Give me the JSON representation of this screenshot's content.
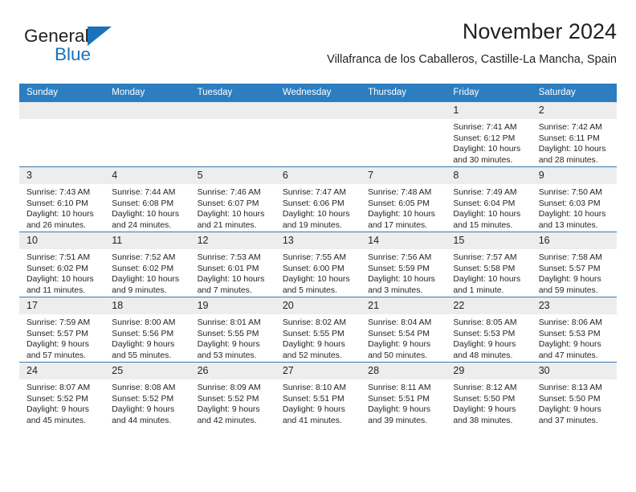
{
  "brand": {
    "name_part1": "General",
    "name_part2": "Blue",
    "accent_color": "#1a72ba"
  },
  "header": {
    "title": "November 2024",
    "subtitle": "Villafranca de los Caballeros, Castille-La Mancha, Spain"
  },
  "theme": {
    "header_row_color": "#2d7dc1",
    "daynum_bg": "#ededed",
    "border_color": "#3c78aa"
  },
  "weekdays": [
    "Sunday",
    "Monday",
    "Tuesday",
    "Wednesday",
    "Thursday",
    "Friday",
    "Saturday"
  ],
  "labels": {
    "sunrise_prefix": "Sunrise:",
    "sunset_prefix": "Sunset:",
    "daylight_prefix": "Daylight:"
  },
  "weeks": [
    [
      {
        "day": "",
        "empty": true
      },
      {
        "day": "",
        "empty": true
      },
      {
        "day": "",
        "empty": true
      },
      {
        "day": "",
        "empty": true
      },
      {
        "day": "",
        "empty": true
      },
      {
        "day": "1",
        "sunrise": "Sunrise: 7:41 AM",
        "sunset": "Sunset: 6:12 PM",
        "daylight_1": "Daylight: 10 hours",
        "daylight_2": "and 30 minutes."
      },
      {
        "day": "2",
        "sunrise": "Sunrise: 7:42 AM",
        "sunset": "Sunset: 6:11 PM",
        "daylight_1": "Daylight: 10 hours",
        "daylight_2": "and 28 minutes."
      }
    ],
    [
      {
        "day": "3",
        "sunrise": "Sunrise: 7:43 AM",
        "sunset": "Sunset: 6:10 PM",
        "daylight_1": "Daylight: 10 hours",
        "daylight_2": "and 26 minutes."
      },
      {
        "day": "4",
        "sunrise": "Sunrise: 7:44 AM",
        "sunset": "Sunset: 6:08 PM",
        "daylight_1": "Daylight: 10 hours",
        "daylight_2": "and 24 minutes."
      },
      {
        "day": "5",
        "sunrise": "Sunrise: 7:46 AM",
        "sunset": "Sunset: 6:07 PM",
        "daylight_1": "Daylight: 10 hours",
        "daylight_2": "and 21 minutes."
      },
      {
        "day": "6",
        "sunrise": "Sunrise: 7:47 AM",
        "sunset": "Sunset: 6:06 PM",
        "daylight_1": "Daylight: 10 hours",
        "daylight_2": "and 19 minutes."
      },
      {
        "day": "7",
        "sunrise": "Sunrise: 7:48 AM",
        "sunset": "Sunset: 6:05 PM",
        "daylight_1": "Daylight: 10 hours",
        "daylight_2": "and 17 minutes."
      },
      {
        "day": "8",
        "sunrise": "Sunrise: 7:49 AM",
        "sunset": "Sunset: 6:04 PM",
        "daylight_1": "Daylight: 10 hours",
        "daylight_2": "and 15 minutes."
      },
      {
        "day": "9",
        "sunrise": "Sunrise: 7:50 AM",
        "sunset": "Sunset: 6:03 PM",
        "daylight_1": "Daylight: 10 hours",
        "daylight_2": "and 13 minutes."
      }
    ],
    [
      {
        "day": "10",
        "sunrise": "Sunrise: 7:51 AM",
        "sunset": "Sunset: 6:02 PM",
        "daylight_1": "Daylight: 10 hours",
        "daylight_2": "and 11 minutes."
      },
      {
        "day": "11",
        "sunrise": "Sunrise: 7:52 AM",
        "sunset": "Sunset: 6:02 PM",
        "daylight_1": "Daylight: 10 hours",
        "daylight_2": "and 9 minutes."
      },
      {
        "day": "12",
        "sunrise": "Sunrise: 7:53 AM",
        "sunset": "Sunset: 6:01 PM",
        "daylight_1": "Daylight: 10 hours",
        "daylight_2": "and 7 minutes."
      },
      {
        "day": "13",
        "sunrise": "Sunrise: 7:55 AM",
        "sunset": "Sunset: 6:00 PM",
        "daylight_1": "Daylight: 10 hours",
        "daylight_2": "and 5 minutes."
      },
      {
        "day": "14",
        "sunrise": "Sunrise: 7:56 AM",
        "sunset": "Sunset: 5:59 PM",
        "daylight_1": "Daylight: 10 hours",
        "daylight_2": "and 3 minutes."
      },
      {
        "day": "15",
        "sunrise": "Sunrise: 7:57 AM",
        "sunset": "Sunset: 5:58 PM",
        "daylight_1": "Daylight: 10 hours",
        "daylight_2": "and 1 minute."
      },
      {
        "day": "16",
        "sunrise": "Sunrise: 7:58 AM",
        "sunset": "Sunset: 5:57 PM",
        "daylight_1": "Daylight: 9 hours",
        "daylight_2": "and 59 minutes."
      }
    ],
    [
      {
        "day": "17",
        "sunrise": "Sunrise: 7:59 AM",
        "sunset": "Sunset: 5:57 PM",
        "daylight_1": "Daylight: 9 hours",
        "daylight_2": "and 57 minutes."
      },
      {
        "day": "18",
        "sunrise": "Sunrise: 8:00 AM",
        "sunset": "Sunset: 5:56 PM",
        "daylight_1": "Daylight: 9 hours",
        "daylight_2": "and 55 minutes."
      },
      {
        "day": "19",
        "sunrise": "Sunrise: 8:01 AM",
        "sunset": "Sunset: 5:55 PM",
        "daylight_1": "Daylight: 9 hours",
        "daylight_2": "and 53 minutes."
      },
      {
        "day": "20",
        "sunrise": "Sunrise: 8:02 AM",
        "sunset": "Sunset: 5:55 PM",
        "daylight_1": "Daylight: 9 hours",
        "daylight_2": "and 52 minutes."
      },
      {
        "day": "21",
        "sunrise": "Sunrise: 8:04 AM",
        "sunset": "Sunset: 5:54 PM",
        "daylight_1": "Daylight: 9 hours",
        "daylight_2": "and 50 minutes."
      },
      {
        "day": "22",
        "sunrise": "Sunrise: 8:05 AM",
        "sunset": "Sunset: 5:53 PM",
        "daylight_1": "Daylight: 9 hours",
        "daylight_2": "and 48 minutes."
      },
      {
        "day": "23",
        "sunrise": "Sunrise: 8:06 AM",
        "sunset": "Sunset: 5:53 PM",
        "daylight_1": "Daylight: 9 hours",
        "daylight_2": "and 47 minutes."
      }
    ],
    [
      {
        "day": "24",
        "sunrise": "Sunrise: 8:07 AM",
        "sunset": "Sunset: 5:52 PM",
        "daylight_1": "Daylight: 9 hours",
        "daylight_2": "and 45 minutes."
      },
      {
        "day": "25",
        "sunrise": "Sunrise: 8:08 AM",
        "sunset": "Sunset: 5:52 PM",
        "daylight_1": "Daylight: 9 hours",
        "daylight_2": "and 44 minutes."
      },
      {
        "day": "26",
        "sunrise": "Sunrise: 8:09 AM",
        "sunset": "Sunset: 5:52 PM",
        "daylight_1": "Daylight: 9 hours",
        "daylight_2": "and 42 minutes."
      },
      {
        "day": "27",
        "sunrise": "Sunrise: 8:10 AM",
        "sunset": "Sunset: 5:51 PM",
        "daylight_1": "Daylight: 9 hours",
        "daylight_2": "and 41 minutes."
      },
      {
        "day": "28",
        "sunrise": "Sunrise: 8:11 AM",
        "sunset": "Sunset: 5:51 PM",
        "daylight_1": "Daylight: 9 hours",
        "daylight_2": "and 39 minutes."
      },
      {
        "day": "29",
        "sunrise": "Sunrise: 8:12 AM",
        "sunset": "Sunset: 5:50 PM",
        "daylight_1": "Daylight: 9 hours",
        "daylight_2": "and 38 minutes."
      },
      {
        "day": "30",
        "sunrise": "Sunrise: 8:13 AM",
        "sunset": "Sunset: 5:50 PM",
        "daylight_1": "Daylight: 9 hours",
        "daylight_2": "and 37 minutes."
      }
    ]
  ]
}
